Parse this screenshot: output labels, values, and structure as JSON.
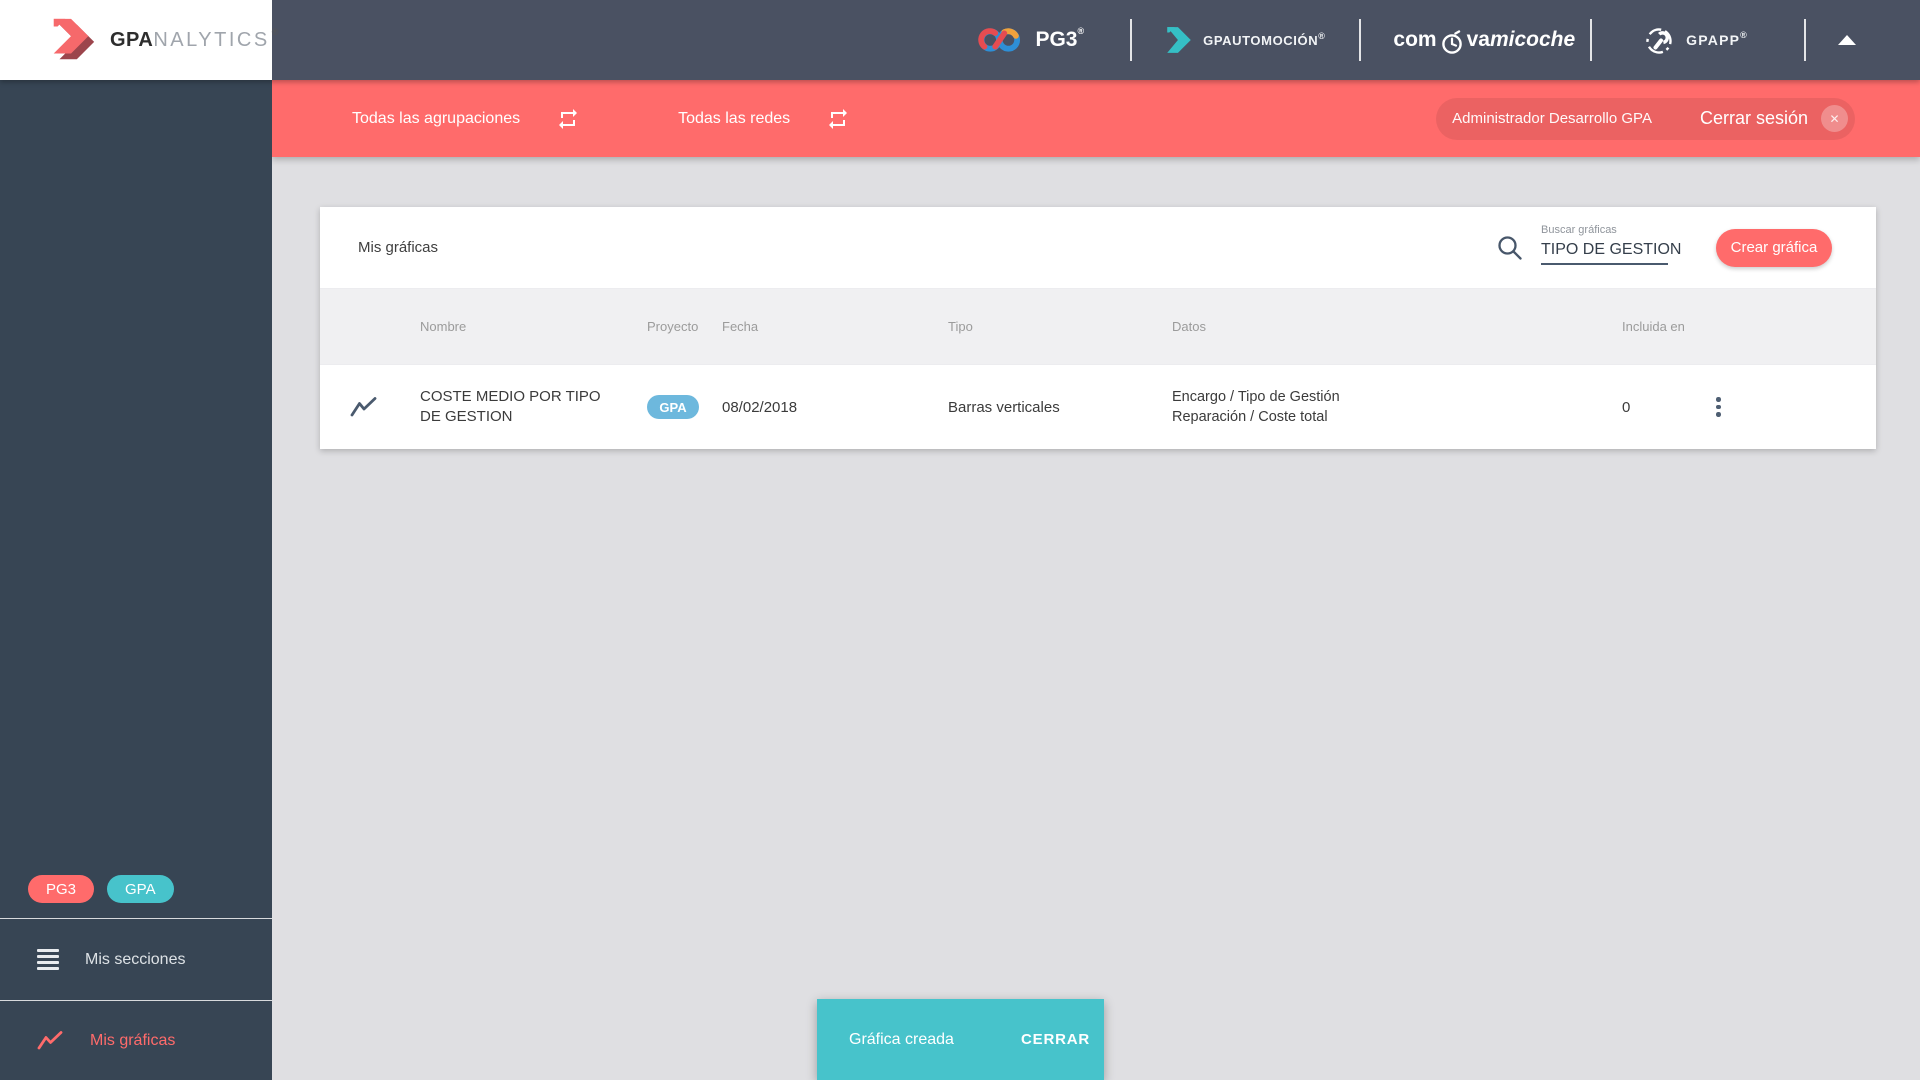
{
  "colors": {
    "accent_red": "#ff6b6b",
    "accent_teal": "#47c3cb",
    "project_badge_blue": "#6db8dd",
    "header_bg": "#4a5162",
    "sidebar_bg": "#374554",
    "main_bg": "#dfdfe2"
  },
  "topbar": {
    "analytics_bold": "GPA",
    "analytics_light": "NALYTICS",
    "reg": "®",
    "pg3": "PG3",
    "gpautomocion": "GPAUTOMOCIÓN",
    "comprava_prefix": "com",
    "comprava_mid": "va",
    "comprava_suffix": "micoche",
    "gpapp": "GPAPP"
  },
  "filterbar": {
    "groupings": "Todas las agrupaciones",
    "networks": "Todas las redes",
    "user": "Administrador Desarrollo GPA",
    "logout": "Cerrar sesión",
    "logout_icon": "✕"
  },
  "sidebar": {
    "badges": [
      {
        "label": "PG3"
      },
      {
        "label": "GPA"
      }
    ],
    "items": [
      {
        "label": "Mis secciones",
        "active": false
      },
      {
        "label": "Mis gráficas",
        "active": true
      }
    ]
  },
  "content": {
    "title": "Mis gráficas",
    "search_label": "Buscar gráficas",
    "search_value": "TIPO DE GESTION",
    "create_button": "Crear gráfica",
    "columns": [
      "Nombre",
      "Proyecto",
      "Fecha",
      "Tipo",
      "Datos",
      "Incluida en"
    ],
    "row": {
      "name": "COSTE MEDIO POR TIPO DE GESTION",
      "project": "GPA",
      "date": "08/02/2018",
      "type": "Barras verticales",
      "data_line1": "Encargo / Tipo de Gestión",
      "data_line2": "Reparación / Coste total",
      "included_count": "0"
    }
  },
  "toast": {
    "message": "Gráfica creada",
    "action": "CERRAR"
  }
}
